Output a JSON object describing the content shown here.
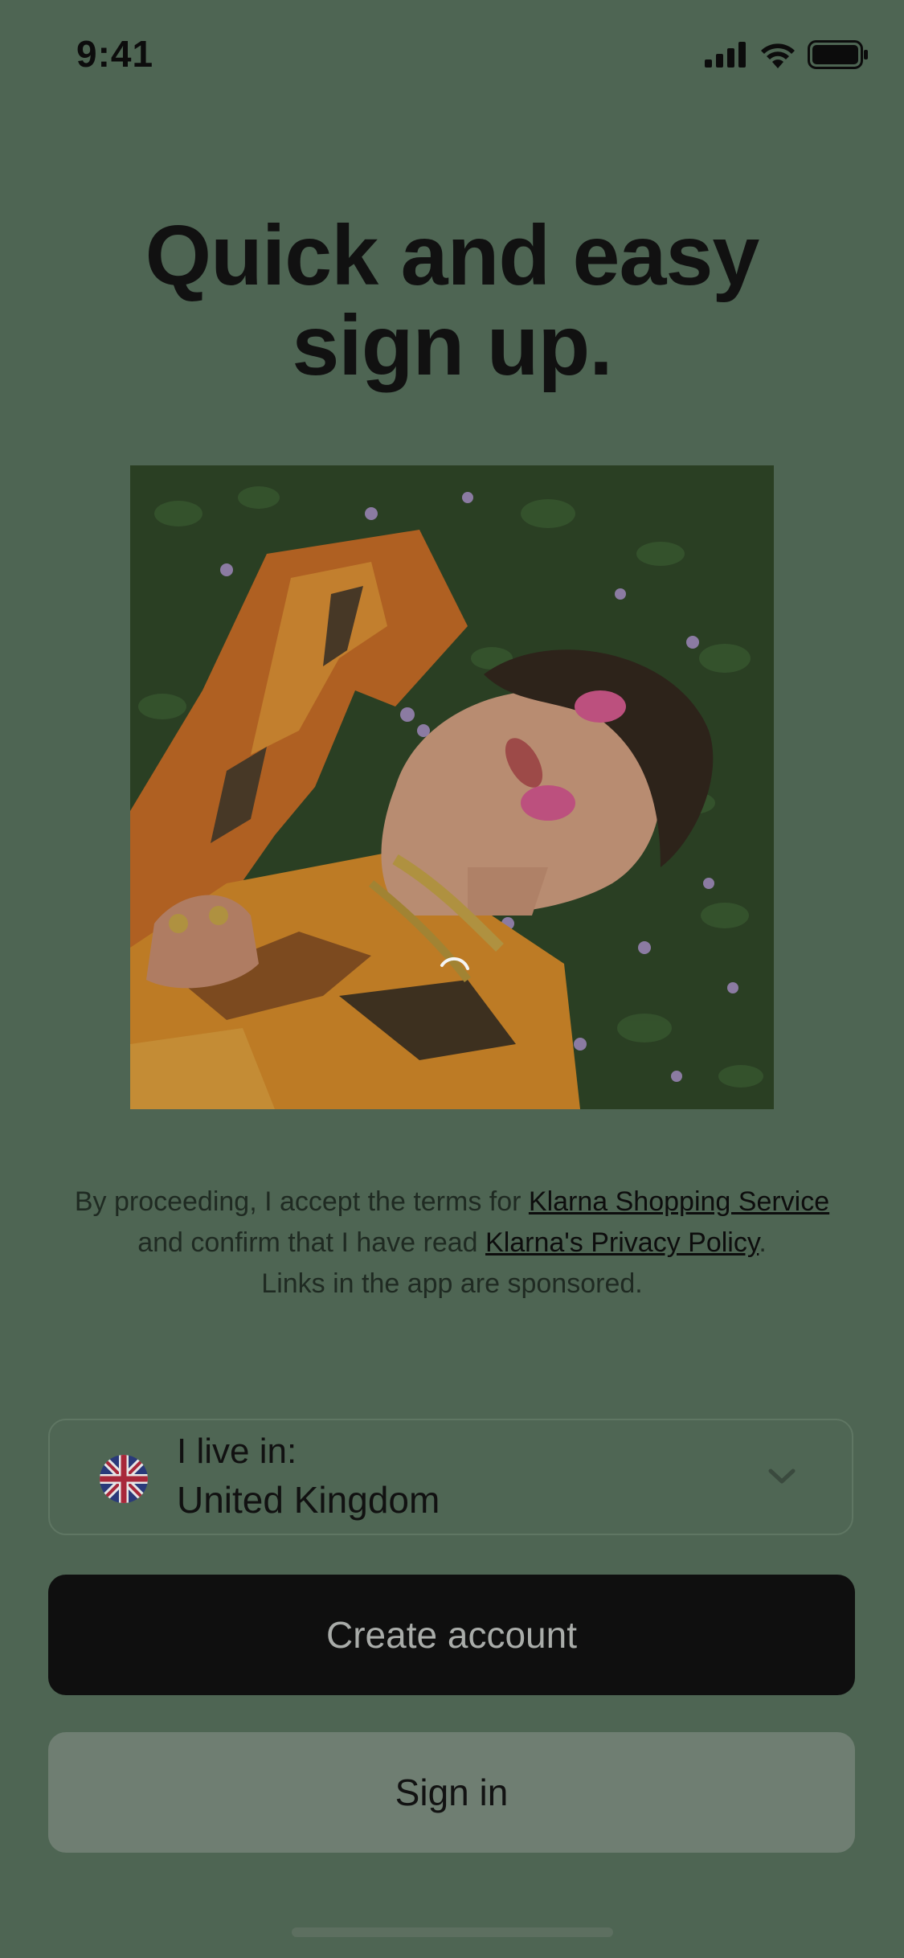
{
  "status_bar": {
    "time": "9:41"
  },
  "header": {
    "title_line1": "Quick and easy",
    "title_line2": "sign up."
  },
  "legal": {
    "prefix": "By proceeding, I accept the terms for ",
    "link_service": "Klarna Shopping Service",
    "middle": " and confirm that I have read ",
    "link_privacy": "Klarna's Privacy Policy",
    "suffix": ".",
    "sponsored_note": "Links in the app are sponsored."
  },
  "country_selector": {
    "label": "I live in:",
    "value": "United Kingdom",
    "flag_icon": "uk-flag-icon"
  },
  "buttons": {
    "create_account": "Create account",
    "sign_in": "Sign in"
  },
  "colors": {
    "background": "#4e6553",
    "primary_button": "#0f0f0f",
    "secondary_button": "#6f7e72"
  }
}
